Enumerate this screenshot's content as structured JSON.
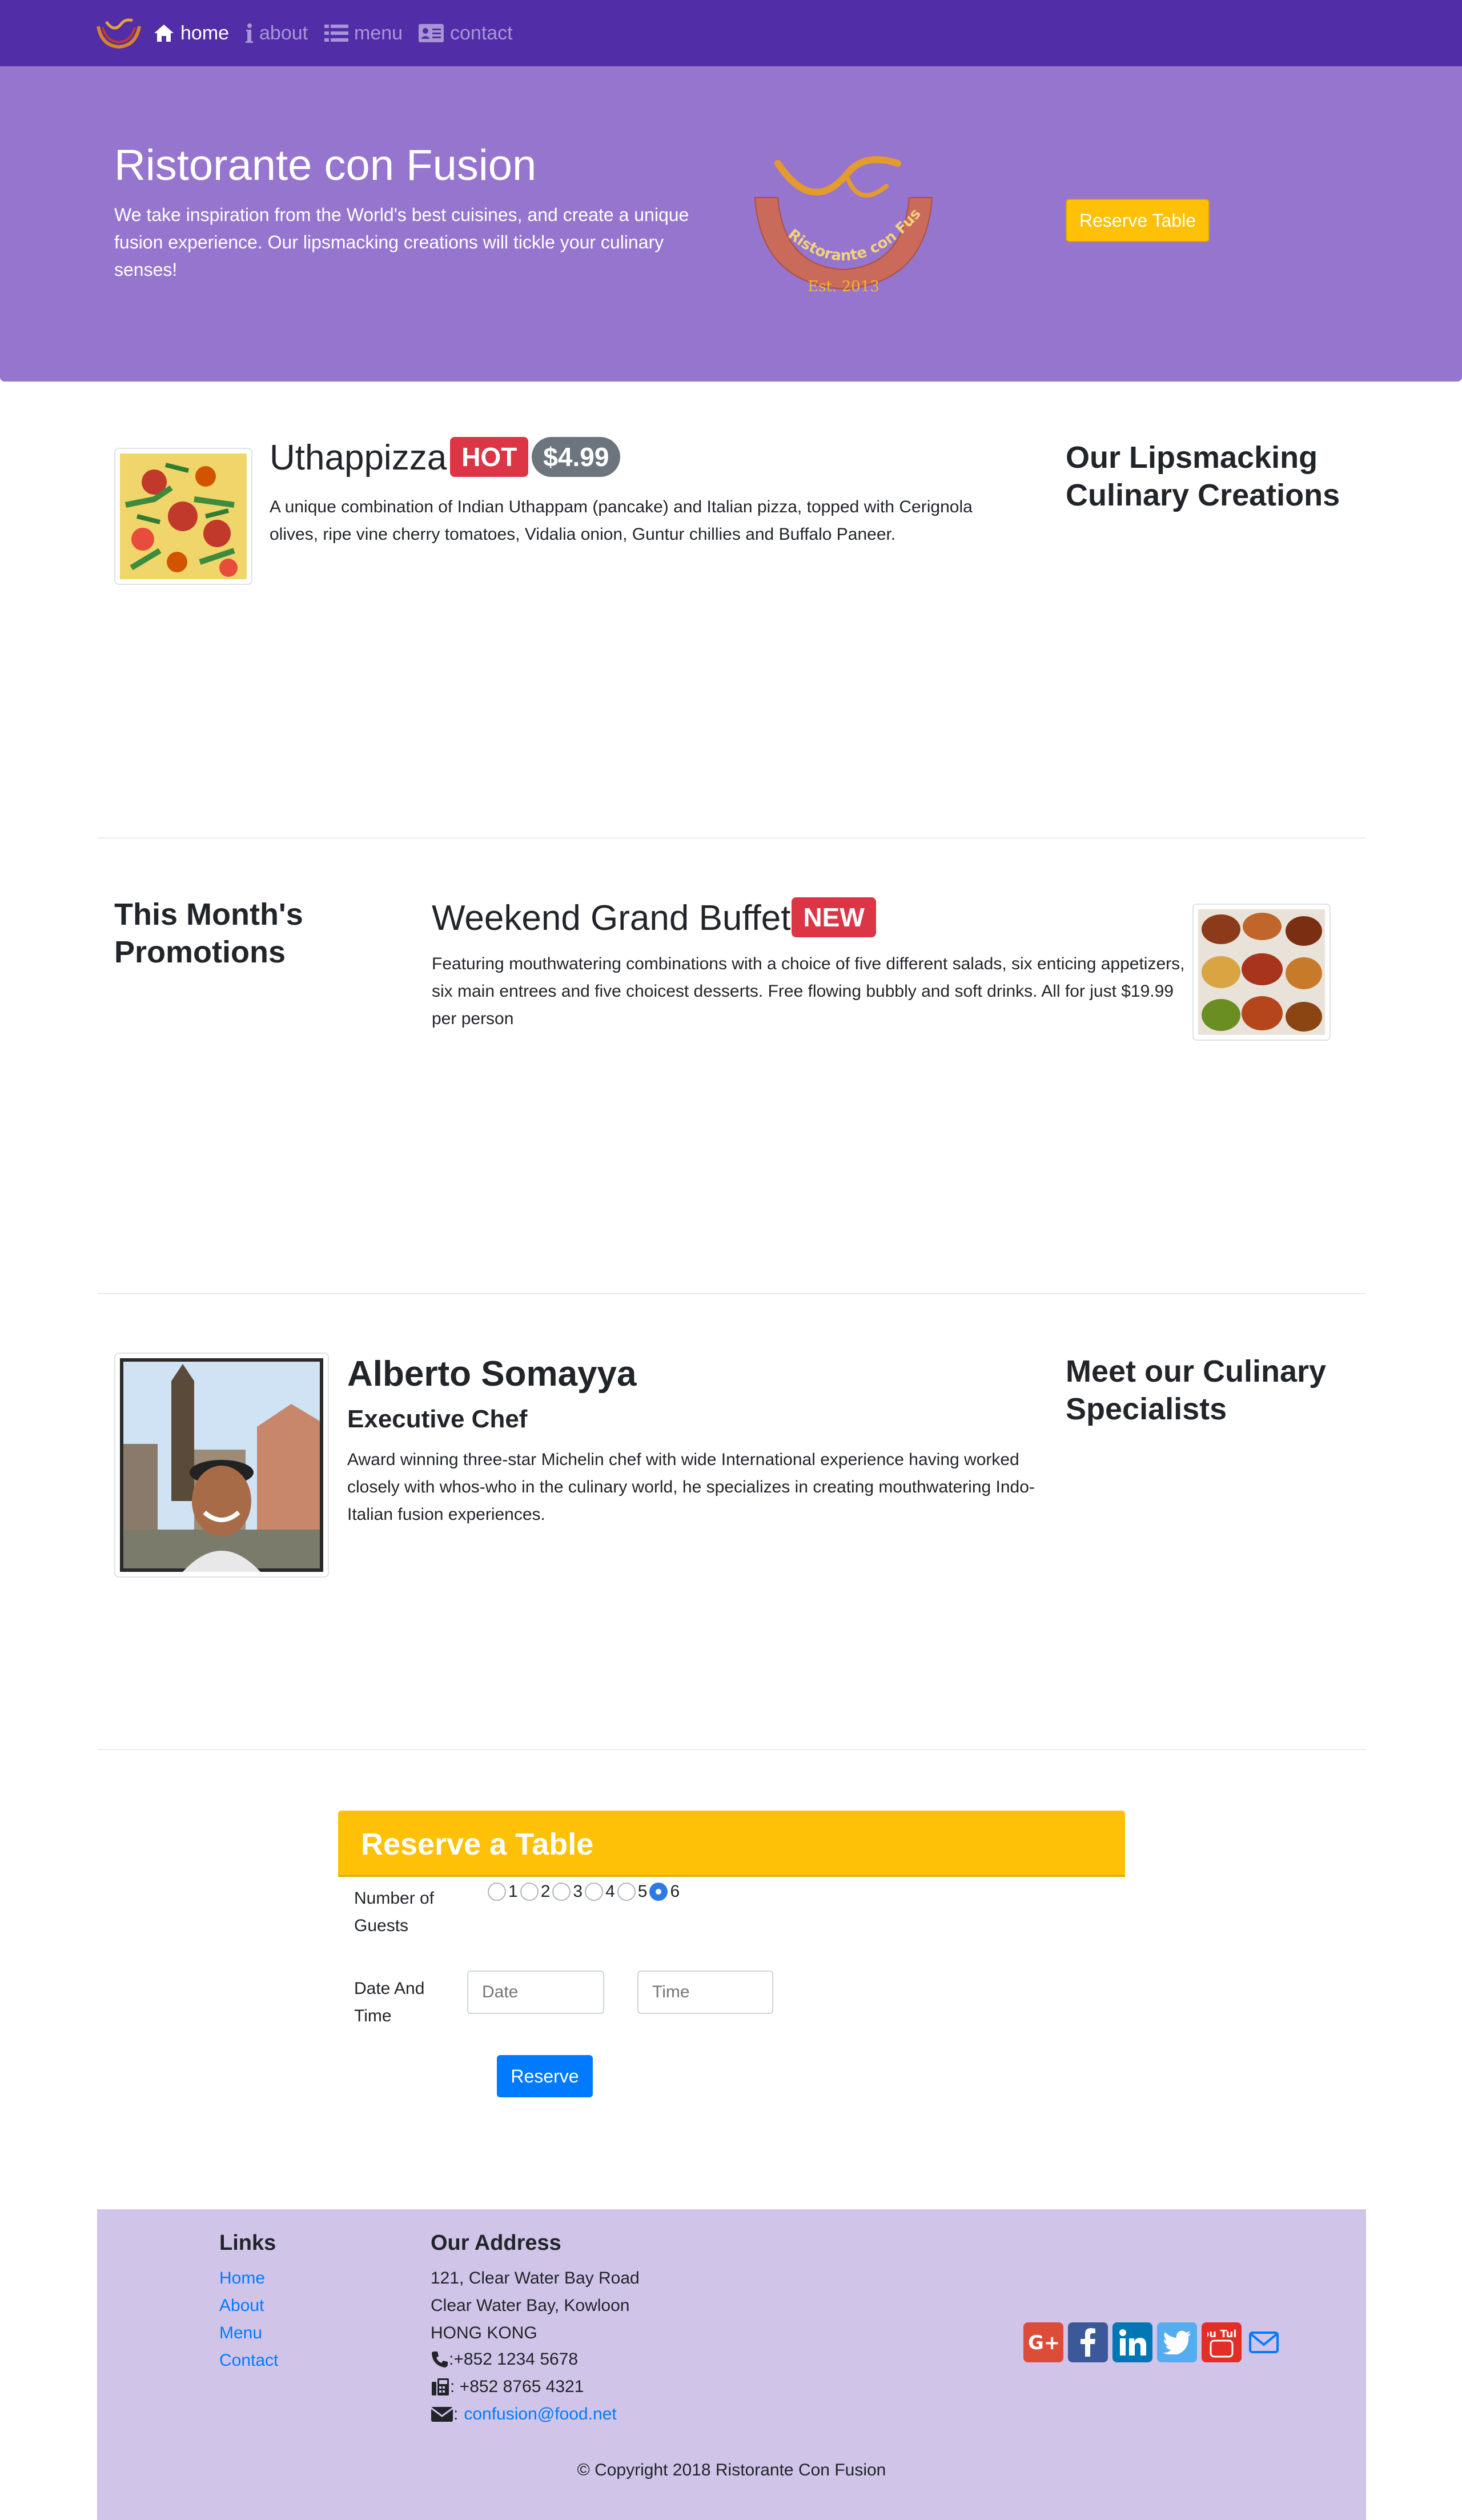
{
  "nav": {
    "items": [
      {
        "label": "home",
        "icon": "home-icon",
        "active": true
      },
      {
        "label": "about",
        "icon": "info-icon",
        "active": false
      },
      {
        "label": "menu",
        "icon": "list-icon",
        "active": false
      },
      {
        "label": "contact",
        "icon": "address-card-icon",
        "active": false
      }
    ]
  },
  "jumbotron": {
    "title": "Ristorante con Fusion",
    "text": "We take inspiration from the World's best cuisines, and create a unique fusion experience. Our lipsmacking creations will tickle your culinary senses!",
    "logo_text": "Ristorante con Fusion",
    "logo_est": "Est. 2013",
    "reserve_button": "Reserve Table"
  },
  "dish": {
    "name": "Uthappizza",
    "badge": "HOT",
    "price": "$4.99",
    "description": "A unique combination of Indian Uthappam (pancake) and Italian pizza, topped with Cerignola olives, ripe vine cherry tomatoes, Vidalia onion, Guntur chillies and Buffalo Paneer.",
    "side_heading": "Our Lipsmacking Culinary Creations"
  },
  "promotion": {
    "side_heading": "This Month's Promotions",
    "name": "Weekend Grand Buffet",
    "badge": "NEW",
    "description": "Featuring mouthwatering combinations with a choice of five different salads, six enticing appetizers, six main entrees and five choicest desserts. Free flowing bubbly and soft drinks. All for just $19.99 per person"
  },
  "leader": {
    "name": "Alberto Somayya",
    "designation": "Executive Chef",
    "description": "Award winning three-star Michelin chef with wide International experience having worked closely with whos-who in the culinary world, he specializes in creating mouthwatering Indo-Italian fusion experiences.",
    "side_heading": "Meet our Culinary Specialists"
  },
  "reserve": {
    "title": "Reserve a Table",
    "guests_label": "Number of Guests",
    "guest_options": [
      "1",
      "2",
      "3",
      "4",
      "5",
      "6"
    ],
    "guests_selected": "6",
    "datetime_label": "Date And Time",
    "date_placeholder": "Date",
    "time_placeholder": "Time",
    "submit": "Reserve"
  },
  "footer": {
    "links_heading": "Links",
    "links": [
      "Home",
      "About",
      "Menu",
      "Contact"
    ],
    "address_heading": "Our Address",
    "address_lines": [
      "121, Clear Water Bay Road",
      "Clear Water Bay, Kowloon",
      "HONG KONG"
    ],
    "phone": ":+852 1234 5678",
    "fax": ": +852 8765 4321",
    "email_prefix": ":",
    "email": "confusion@food.net",
    "social": [
      "google-plus-icon",
      "facebook-icon",
      "linkedin-icon",
      "twitter-icon",
      "youtube-icon",
      "envelope-icon"
    ],
    "youtube_text": "You Tube",
    "copyright": "© Copyright 2018 Ristorante Con Fusion"
  },
  "colors": {
    "navbar": "#512da8",
    "jumbotron": "#9575cd",
    "footer": "#d1c4e9",
    "warning": "#ffc107",
    "danger": "#dc3545",
    "primary": "#007bff"
  }
}
